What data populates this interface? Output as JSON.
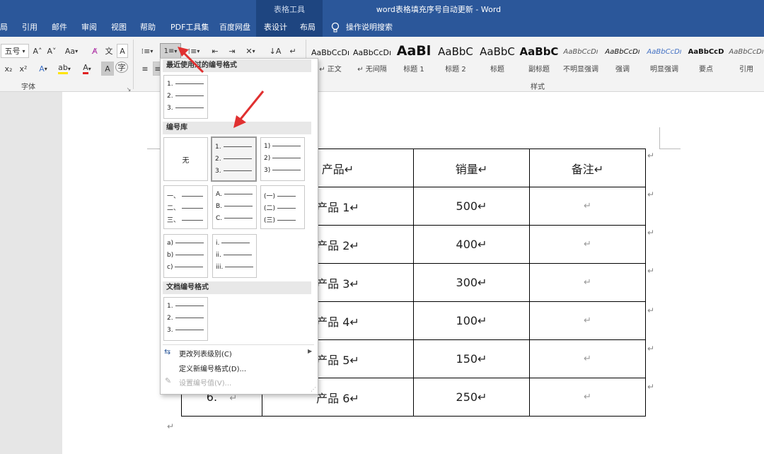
{
  "titlebar": {
    "context_tab": "表格工具",
    "title": "word表格填充序号自动更新  -  Word"
  },
  "menu": {
    "tabs": [
      "局",
      "引用",
      "邮件",
      "审阅",
      "视图",
      "帮助",
      "PDF工具集",
      "百度网盘",
      "表设计",
      "布局"
    ],
    "search": "操作说明搜索"
  },
  "ribbon": {
    "font_size": "五号",
    "grow": "A˄",
    "shrink": "A˅",
    "case": "Aa",
    "font_group_label": "字体",
    "styles_group_label": "样式",
    "wen": "文",
    "A_box": "A"
  },
  "styles": [
    {
      "sample": "AaBbCcDı",
      "label": "↵ 正文"
    },
    {
      "sample": "AaBbCcDı",
      "label": "↵ 无间隔"
    },
    {
      "sample": "AaBl",
      "label": "标题 1"
    },
    {
      "sample": "AaBbC",
      "label": "标题 2"
    },
    {
      "sample": "AaBbC",
      "label": "标题"
    },
    {
      "sample": "AaBbC",
      "label": "副标题"
    },
    {
      "sample": "AaBbCcDı",
      "label": "不明显强调"
    },
    {
      "sample": "AaBbCcDı",
      "label": "强调"
    },
    {
      "sample": "AaBbCcDı",
      "label": "明显强调"
    },
    {
      "sample": "AaBbCcD",
      "label": "要点"
    },
    {
      "sample": "AaBbCcDı",
      "label": "引用"
    }
  ],
  "dropdown": {
    "recent_header": "最近使用过的编号格式",
    "library_header": "编号库",
    "doc_header": "文档编号格式",
    "none_label": "无",
    "recent": [
      "1.",
      "2.",
      "3."
    ],
    "tiles": [
      [
        "1.",
        "2.",
        "3."
      ],
      [
        "1)",
        "2)",
        "3)"
      ],
      [
        "一、",
        "二、",
        "三、"
      ],
      [
        "A.",
        "B.",
        "C."
      ],
      [
        "(一)",
        "(二)",
        "(三)"
      ],
      [
        "a)",
        "b)",
        "c)"
      ],
      [
        "i.",
        "ii.",
        "iii."
      ]
    ],
    "doc": [
      "1.",
      "2.",
      "3."
    ],
    "menu_items": [
      "更改列表级别(C)",
      "定义新编号格式(D)...",
      "设置编号值(V)..."
    ]
  },
  "table": {
    "headers": [
      "产品↵",
      "销量↵",
      "备注↵"
    ],
    "rows": [
      {
        "product": "产品 1↵",
        "sales": "500↵",
        "note": "↵"
      },
      {
        "product": "产品 2↵",
        "sales": "400↵",
        "note": "↵"
      },
      {
        "product": "产品 3↵",
        "sales": "300↵",
        "note": "↵"
      },
      {
        "product": "产品 4↵",
        "sales": "100↵",
        "note": "↵"
      },
      {
        "product": "产品 5↵",
        "sales": "150↵",
        "note": "↵"
      },
      {
        "product": "产品 6↵",
        "sales": "250↵",
        "note": "↵"
      }
    ],
    "last_number": "6.",
    "last_mark": "↵",
    "para_mark": "↵"
  },
  "accent": "#2b579a",
  "arrow_color": "#e03030"
}
